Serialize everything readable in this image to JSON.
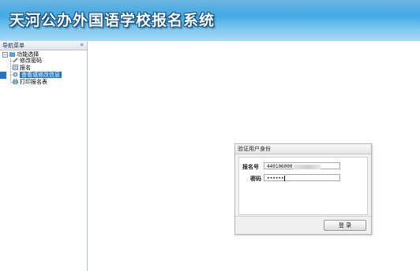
{
  "header": {
    "title": "天河公办外国语学校报名系统"
  },
  "sidebar": {
    "title": "导航菜单",
    "collapse_glyph": "«",
    "root": {
      "label": "功能选择",
      "expander": "⊟"
    },
    "items": [
      {
        "label": "修改密码",
        "icon": "pencil-icon"
      },
      {
        "label": "报名",
        "icon": "document-icon"
      },
      {
        "label": "查看或修改信息",
        "icon": "gear-icon",
        "selected": true
      },
      {
        "label": "打印报名表",
        "icon": "printer-icon"
      }
    ]
  },
  "login": {
    "title": "验证用户身份",
    "registration_label": "报名号",
    "registration_value": "440106000",
    "password_label": "密码",
    "password_value": "••••••",
    "submit_label": "登 录"
  },
  "colors": {
    "selection": "#1e77cc",
    "header_top": "#1f8fd0",
    "header_bottom": "#a9dbf6"
  }
}
